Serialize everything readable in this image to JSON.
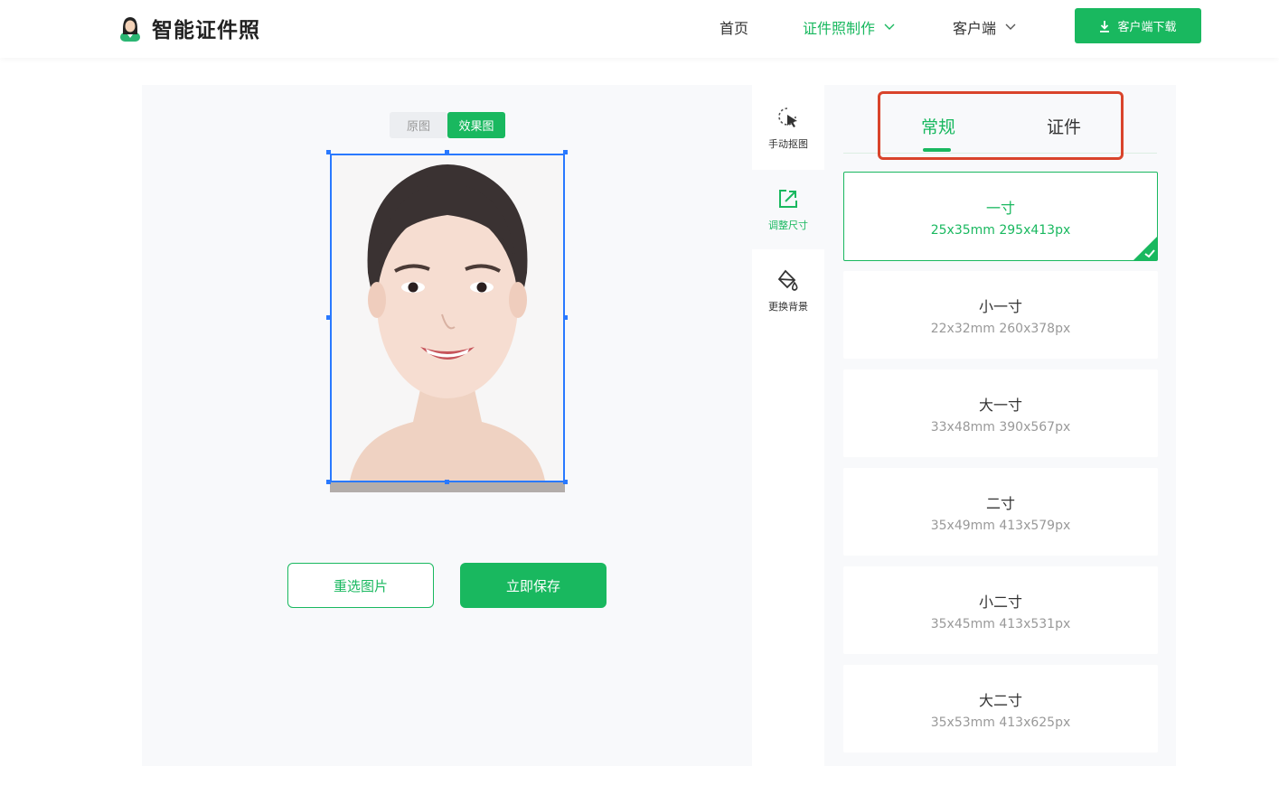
{
  "header": {
    "logo_text": "智能证件照",
    "nav": [
      {
        "label": "首页"
      },
      {
        "label": "证件照制作"
      },
      {
        "label": "客户端"
      }
    ],
    "download_label": "客户端下载"
  },
  "editor": {
    "toggle": {
      "original": "原图",
      "effect": "效果图"
    },
    "reselect_label": "重选图片",
    "save_label": "立即保存"
  },
  "tools": [
    {
      "label": "手动抠图",
      "icon": "cursor-select-icon"
    },
    {
      "label": "调整尺寸",
      "icon": "resize-icon"
    },
    {
      "label": "更换背景",
      "icon": "paint-bucket-icon"
    }
  ],
  "size_panel": {
    "tabs": [
      {
        "label": "常规"
      },
      {
        "label": "证件"
      }
    ],
    "items": [
      {
        "name": "一寸",
        "spec": "25x35mm 295x413px"
      },
      {
        "name": "小一寸",
        "spec": "22x32mm 260x378px"
      },
      {
        "name": "大一寸",
        "spec": "33x48mm 390x567px"
      },
      {
        "name": "二寸",
        "spec": "35x49mm 413x579px"
      },
      {
        "name": "小二寸",
        "spec": "35x45mm 413x531px"
      },
      {
        "name": "大二寸",
        "spec": "35x53mm 413x625px"
      }
    ]
  },
  "colors": {
    "accent": "#19b85f",
    "highlight_box": "#d9442b",
    "selection": "#2979ff"
  }
}
